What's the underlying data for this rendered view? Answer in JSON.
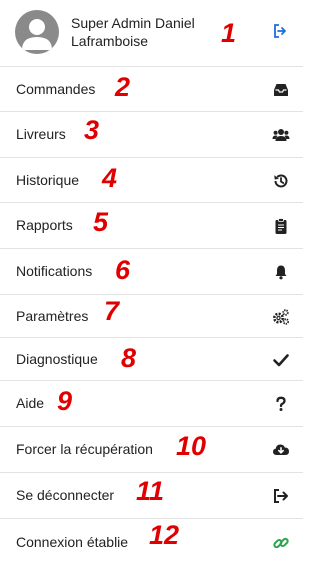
{
  "header": {
    "user_name": "Super Admin Daniel Laframboise",
    "logout_icon": "sign-out-icon",
    "number": "1"
  },
  "menu": [
    {
      "label": "Commandes",
      "icon": "inbox-icon",
      "number": "2"
    },
    {
      "label": "Livreurs",
      "icon": "users-icon",
      "number": "3"
    },
    {
      "label": "Historique",
      "icon": "history-icon",
      "number": "4"
    },
    {
      "label": "Rapports",
      "icon": "clipboard-icon",
      "number": "5"
    },
    {
      "label": "Notifications",
      "icon": "bell-icon",
      "number": "6"
    },
    {
      "label": "Paramètres",
      "icon": "cogs-icon",
      "number": "7"
    },
    {
      "label": "Diagnostique",
      "icon": "check-icon",
      "number": "8"
    },
    {
      "label": "Aide",
      "icon": "question-icon",
      "number": "9"
    },
    {
      "label": "Forcer la récupération",
      "icon": "cloud-download-icon",
      "number": "10"
    },
    {
      "label": "Se déconnecter",
      "icon": "sign-out-icon",
      "number": "11"
    },
    {
      "label": "Connexion établie",
      "icon": "link-icon",
      "number": "12"
    }
  ],
  "colors": {
    "accent": "#1e6fdc",
    "connected": "#2ea44f",
    "annotation": "#e10000"
  }
}
